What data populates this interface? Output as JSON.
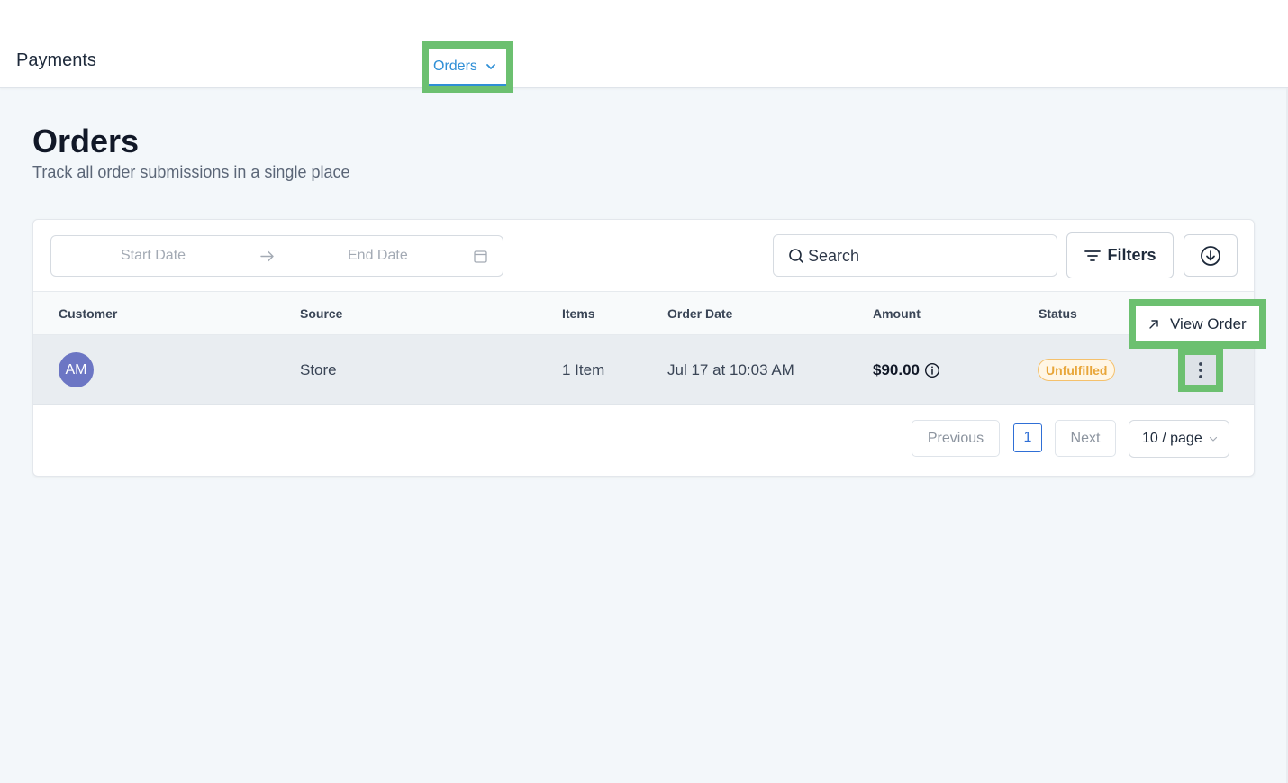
{
  "header": {
    "app_title": "Payments",
    "nav_active": "Orders"
  },
  "page": {
    "title": "Orders",
    "subtitle": "Track all order submissions in a single place"
  },
  "toolbar": {
    "start_date_placeholder": "Start Date",
    "end_date_placeholder": "End Date",
    "search_placeholder": "Search",
    "filters_label": "Filters"
  },
  "table": {
    "columns": [
      "Customer",
      "Source",
      "Items",
      "Order Date",
      "Amount",
      "Status"
    ],
    "rows": [
      {
        "initials": "AM",
        "source": "Store",
        "items": "1 Item",
        "order_date": "Jul 17 at 10:03 AM",
        "amount": "$90.00",
        "status": "Unfulfilled"
      }
    ]
  },
  "row_menu": {
    "view_order": "View Order"
  },
  "pagination": {
    "previous": "Previous",
    "current": "1",
    "next": "Next",
    "page_size": "10 / page"
  },
  "colors": {
    "accent": "#2f8fd6",
    "highlight": "#6cc070",
    "status_warning": "#e8a63a",
    "avatar": "#6c76c4"
  }
}
